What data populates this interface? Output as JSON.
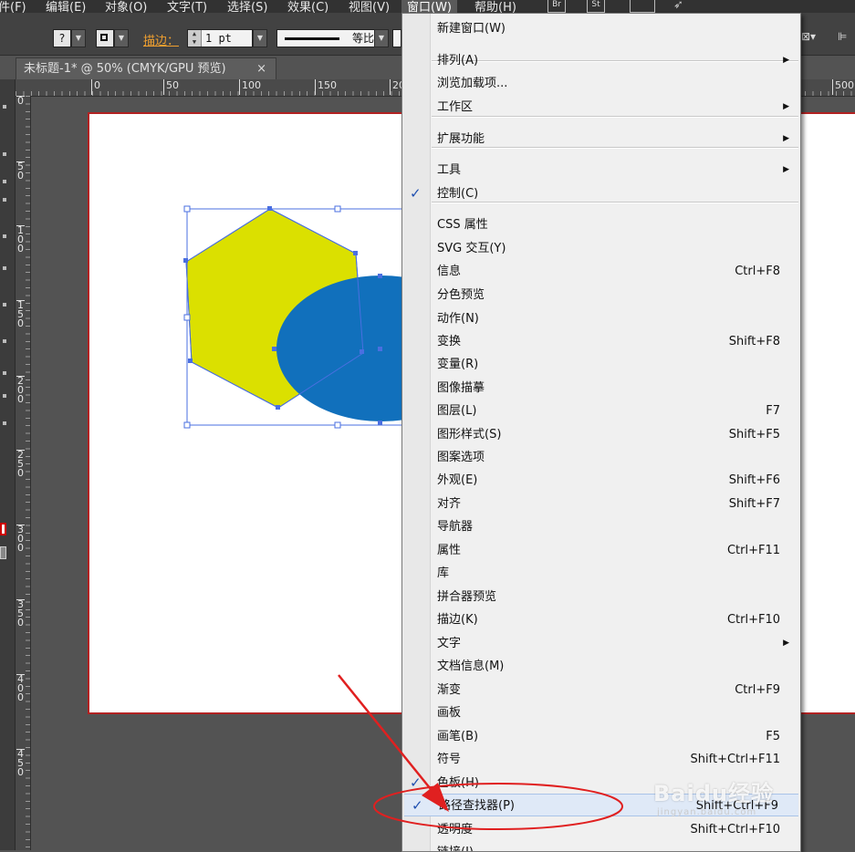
{
  "menubar": {
    "items": [
      {
        "label": "件(F)"
      },
      {
        "label": "编辑(E)"
      },
      {
        "label": "对象(O)"
      },
      {
        "label": "文字(T)"
      },
      {
        "label": "选择(S)"
      },
      {
        "label": "效果(C)"
      },
      {
        "label": "视图(V)"
      },
      {
        "label": "窗口(W)"
      },
      {
        "label": "帮助(H)"
      }
    ],
    "badges": [
      "Br",
      "St"
    ]
  },
  "controlbar": {
    "stroke_label": "描边：",
    "stroke_weight": "1 pt",
    "stroke_profile": "等比"
  },
  "document_tab": {
    "title": "未标题-1* @ 50% (CMYK/GPU 预览)",
    "close": "×"
  },
  "ruler_top": {
    "ticks": [
      "0",
      "50",
      "100",
      "150",
      "20",
      "500"
    ]
  },
  "ruler_left": {
    "ticks": [
      "0",
      "50",
      "100",
      "150",
      "200",
      "250",
      "300",
      "350",
      "400",
      "450"
    ]
  },
  "window_menu": {
    "items": [
      {
        "label": "新建窗口(W)",
        "shortcut": "",
        "submenu": false,
        "checked": false
      },
      {
        "label": "排列(A)",
        "shortcut": "",
        "submenu": true,
        "checked": false
      },
      {
        "label": "浏览加载项...",
        "shortcut": "",
        "submenu": false,
        "checked": false
      },
      {
        "label": "工作区",
        "shortcut": "",
        "submenu": true,
        "checked": false
      },
      {
        "label": "扩展功能",
        "shortcut": "",
        "submenu": true,
        "checked": false
      },
      {
        "label": "工具",
        "shortcut": "",
        "submenu": true,
        "checked": false
      },
      {
        "label": "控制(C)",
        "shortcut": "",
        "submenu": false,
        "checked": true
      },
      {
        "label": "CSS 属性",
        "shortcut": "",
        "submenu": false,
        "checked": false
      },
      {
        "label": "SVG 交互(Y)",
        "shortcut": "",
        "submenu": false,
        "checked": false
      },
      {
        "label": "信息",
        "shortcut": "Ctrl+F8",
        "submenu": false,
        "checked": false
      },
      {
        "label": "分色预览",
        "shortcut": "",
        "submenu": false,
        "checked": false
      },
      {
        "label": "动作(N)",
        "shortcut": "",
        "submenu": false,
        "checked": false
      },
      {
        "label": "变换",
        "shortcut": "Shift+F8",
        "submenu": false,
        "checked": false
      },
      {
        "label": "变量(R)",
        "shortcut": "",
        "submenu": false,
        "checked": false
      },
      {
        "label": "图像描摹",
        "shortcut": "",
        "submenu": false,
        "checked": false
      },
      {
        "label": "图层(L)",
        "shortcut": "F7",
        "submenu": false,
        "checked": false
      },
      {
        "label": "图形样式(S)",
        "shortcut": "Shift+F5",
        "submenu": false,
        "checked": false
      },
      {
        "label": "图案选项",
        "shortcut": "",
        "submenu": false,
        "checked": false
      },
      {
        "label": "外观(E)",
        "shortcut": "Shift+F6",
        "submenu": false,
        "checked": false
      },
      {
        "label": "对齐",
        "shortcut": "Shift+F7",
        "submenu": false,
        "checked": false
      },
      {
        "label": "导航器",
        "shortcut": "",
        "submenu": false,
        "checked": false
      },
      {
        "label": "属性",
        "shortcut": "Ctrl+F11",
        "submenu": false,
        "checked": false
      },
      {
        "label": "库",
        "shortcut": "",
        "submenu": false,
        "checked": false
      },
      {
        "label": "拼合器预览",
        "shortcut": "",
        "submenu": false,
        "checked": false
      },
      {
        "label": "描边(K)",
        "shortcut": "Ctrl+F10",
        "submenu": false,
        "checked": false
      },
      {
        "label": "文字",
        "shortcut": "",
        "submenu": true,
        "checked": false
      },
      {
        "label": "文档信息(M)",
        "shortcut": "",
        "submenu": false,
        "checked": false
      },
      {
        "label": "渐变",
        "shortcut": "Ctrl+F9",
        "submenu": false,
        "checked": false
      },
      {
        "label": "画板",
        "shortcut": "",
        "submenu": false,
        "checked": false
      },
      {
        "label": "画笔(B)",
        "shortcut": "F5",
        "submenu": false,
        "checked": false
      },
      {
        "label": "符号",
        "shortcut": "Shift+Ctrl+F11",
        "submenu": false,
        "checked": false
      },
      {
        "label": "色板(H)",
        "shortcut": "",
        "submenu": false,
        "checked": true
      },
      {
        "label": "路径查找器(P)",
        "shortcut": "Shift+Ctrl+F9",
        "submenu": false,
        "checked": true
      },
      {
        "label": "透明度",
        "shortcut": "Shift+Ctrl+F10",
        "submenu": false,
        "checked": false
      },
      {
        "label": "链接(I)",
        "shortcut": "",
        "submenu": false,
        "checked": false
      }
    ]
  },
  "watermark": {
    "main": "Baidu经验",
    "url": "jingyan.baidu.com"
  },
  "colors": {
    "hexagon_fill": "#dbe000",
    "ellipse_fill": "#1170bc",
    "selection": "#4a6fe0",
    "annotation_red": "#e02020",
    "menu_check": "#2050b0"
  }
}
